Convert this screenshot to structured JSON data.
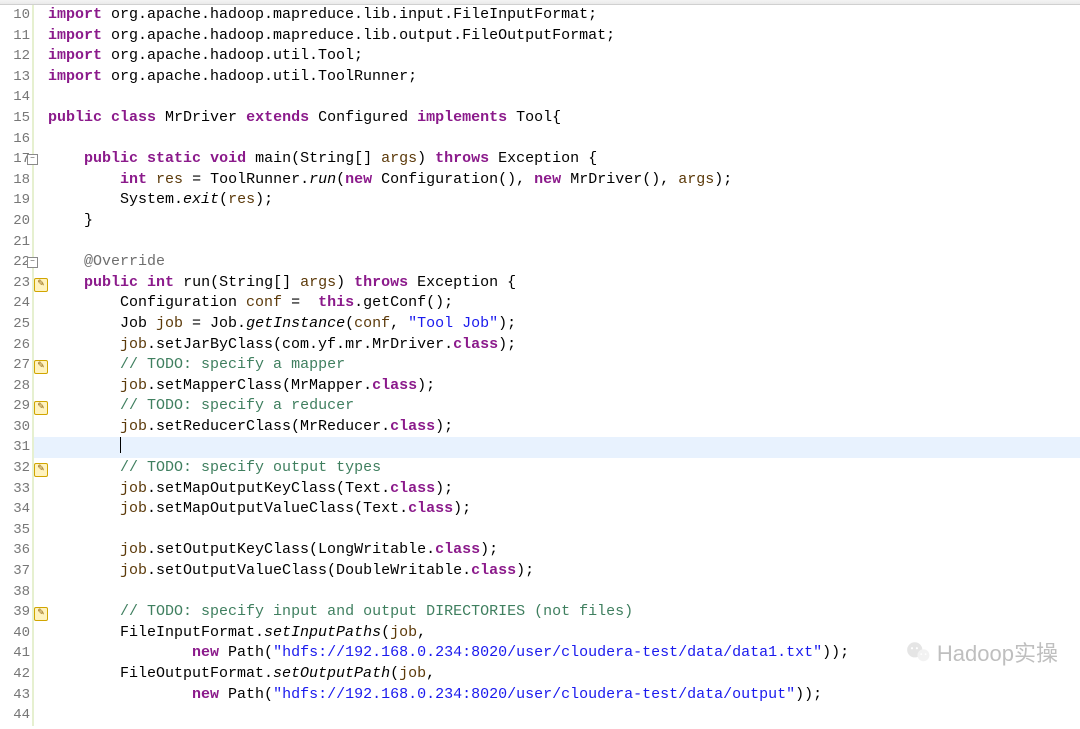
{
  "watermark_text": "Hadoop实操",
  "lines": [
    {
      "num": "10",
      "marker": "",
      "tokens": [
        {
          "c": "kw",
          "t": "import"
        },
        {
          "t": " org.apache.hadoop.mapreduce.lib.input.FileInputFormat;"
        }
      ]
    },
    {
      "num": "11",
      "marker": "",
      "tokens": [
        {
          "c": "kw",
          "t": "import"
        },
        {
          "t": " org.apache.hadoop.mapreduce.lib.output.FileOutputFormat;"
        }
      ]
    },
    {
      "num": "12",
      "marker": "",
      "tokens": [
        {
          "c": "kw",
          "t": "import"
        },
        {
          "t": " org.apache.hadoop.util.Tool;"
        }
      ]
    },
    {
      "num": "13",
      "marker": "",
      "tokens": [
        {
          "c": "kw",
          "t": "import"
        },
        {
          "t": " org.apache.hadoop.util.ToolRunner;"
        }
      ]
    },
    {
      "num": "14",
      "marker": "",
      "tokens": [
        {
          "t": " "
        }
      ]
    },
    {
      "num": "15",
      "marker": "",
      "tokens": [
        {
          "c": "kw",
          "t": "public"
        },
        {
          "t": " "
        },
        {
          "c": "kw",
          "t": "class"
        },
        {
          "t": " MrDriver "
        },
        {
          "c": "kw",
          "t": "extends"
        },
        {
          "t": " Configured "
        },
        {
          "c": "kw",
          "t": "implements"
        },
        {
          "t": " Tool{"
        }
      ]
    },
    {
      "num": "16",
      "marker": "",
      "tokens": [
        {
          "t": " "
        }
      ]
    },
    {
      "num": "17",
      "marker": "minus",
      "tokens": [
        {
          "t": "    "
        },
        {
          "c": "kw",
          "t": "public"
        },
        {
          "t": " "
        },
        {
          "c": "kw",
          "t": "static"
        },
        {
          "t": " "
        },
        {
          "c": "kw",
          "t": "void"
        },
        {
          "t": " main(String[] "
        },
        {
          "c": "param",
          "t": "args"
        },
        {
          "t": ") "
        },
        {
          "c": "kw",
          "t": "throws"
        },
        {
          "t": " Exception {"
        }
      ]
    },
    {
      "num": "18",
      "marker": "",
      "tokens": [
        {
          "t": "        "
        },
        {
          "c": "kw",
          "t": "int"
        },
        {
          "t": " "
        },
        {
          "c": "param",
          "t": "res"
        },
        {
          "t": " = ToolRunner."
        },
        {
          "c": "static-italic",
          "t": "run"
        },
        {
          "t": "("
        },
        {
          "c": "kw",
          "t": "new"
        },
        {
          "t": " Configuration(), "
        },
        {
          "c": "kw",
          "t": "new"
        },
        {
          "t": " MrDriver(), "
        },
        {
          "c": "param",
          "t": "args"
        },
        {
          "t": ");"
        }
      ]
    },
    {
      "num": "19",
      "marker": "",
      "tokens": [
        {
          "t": "        System."
        },
        {
          "c": "static-italic",
          "t": "exit"
        },
        {
          "t": "("
        },
        {
          "c": "param",
          "t": "res"
        },
        {
          "t": ");"
        }
      ]
    },
    {
      "num": "20",
      "marker": "",
      "tokens": [
        {
          "t": "    }"
        }
      ]
    },
    {
      "num": "21",
      "marker": "",
      "tokens": [
        {
          "t": " "
        }
      ]
    },
    {
      "num": "22",
      "marker": "minus",
      "tokens": [
        {
          "t": "    "
        },
        {
          "c": "ann",
          "t": "@Override"
        }
      ]
    },
    {
      "num": "23",
      "marker": "qf",
      "tokens": [
        {
          "t": "    "
        },
        {
          "c": "kw",
          "t": "public"
        },
        {
          "t": " "
        },
        {
          "c": "kw",
          "t": "int"
        },
        {
          "t": " run(String[] "
        },
        {
          "c": "param",
          "t": "args"
        },
        {
          "t": ") "
        },
        {
          "c": "kw",
          "t": "throws"
        },
        {
          "t": " Exception {"
        }
      ]
    },
    {
      "num": "24",
      "marker": "",
      "tokens": [
        {
          "t": "        Configuration "
        },
        {
          "c": "param",
          "t": "conf"
        },
        {
          "t": " =  "
        },
        {
          "c": "kw",
          "t": "this"
        },
        {
          "t": ".getConf();"
        }
      ]
    },
    {
      "num": "25",
      "marker": "",
      "tokens": [
        {
          "t": "        Job "
        },
        {
          "c": "param",
          "t": "job"
        },
        {
          "t": " = Job."
        },
        {
          "c": "static-italic",
          "t": "getInstance"
        },
        {
          "t": "("
        },
        {
          "c": "param",
          "t": "conf"
        },
        {
          "t": ", "
        },
        {
          "c": "str",
          "t": "\"Tool Job\""
        },
        {
          "t": ");"
        }
      ]
    },
    {
      "num": "26",
      "marker": "",
      "tokens": [
        {
          "t": "        "
        },
        {
          "c": "param",
          "t": "job"
        },
        {
          "t": ".setJarByClass(com.yf.mr.MrDriver."
        },
        {
          "c": "kw",
          "t": "class"
        },
        {
          "t": ");"
        }
      ]
    },
    {
      "num": "27",
      "marker": "qf",
      "tokens": [
        {
          "t": "        "
        },
        {
          "c": "comment",
          "t": "// "
        },
        {
          "c": "comment",
          "t": "TODO:"
        },
        {
          "c": "comment",
          "t": " specify a mapper"
        }
      ]
    },
    {
      "num": "28",
      "marker": "",
      "tokens": [
        {
          "t": "        "
        },
        {
          "c": "param",
          "t": "job"
        },
        {
          "t": ".setMapperClass(MrMapper."
        },
        {
          "c": "kw",
          "t": "class"
        },
        {
          "t": ");"
        }
      ]
    },
    {
      "num": "29",
      "marker": "qf",
      "tokens": [
        {
          "t": "        "
        },
        {
          "c": "comment",
          "t": "// "
        },
        {
          "c": "comment",
          "t": "TODO:"
        },
        {
          "c": "comment",
          "t": " specify a reducer"
        }
      ]
    },
    {
      "num": "30",
      "marker": "",
      "tokens": [
        {
          "t": "        "
        },
        {
          "c": "param",
          "t": "job"
        },
        {
          "t": ".setReducerClass(MrReducer."
        },
        {
          "c": "kw",
          "t": "class"
        },
        {
          "t": ");"
        }
      ]
    },
    {
      "num": "31",
      "marker": "",
      "current": true,
      "tokens": [
        {
          "t": "        "
        },
        {
          "cursor": true
        }
      ]
    },
    {
      "num": "32",
      "marker": "qf",
      "tokens": [
        {
          "t": "        "
        },
        {
          "c": "comment",
          "t": "// "
        },
        {
          "c": "comment",
          "t": "TODO:"
        },
        {
          "c": "comment",
          "t": " specify output types"
        }
      ]
    },
    {
      "num": "33",
      "marker": "",
      "tokens": [
        {
          "t": "        "
        },
        {
          "c": "param",
          "t": "job"
        },
        {
          "t": ".setMapOutputKeyClass(Text."
        },
        {
          "c": "kw",
          "t": "class"
        },
        {
          "t": ");"
        }
      ]
    },
    {
      "num": "34",
      "marker": "",
      "tokens": [
        {
          "t": "        "
        },
        {
          "c": "param",
          "t": "job"
        },
        {
          "t": ".setMapOutputValueClass(Text."
        },
        {
          "c": "kw",
          "t": "class"
        },
        {
          "t": ");"
        }
      ]
    },
    {
      "num": "35",
      "marker": "",
      "tokens": [
        {
          "t": " "
        }
      ]
    },
    {
      "num": "36",
      "marker": "",
      "tokens": [
        {
          "t": "        "
        },
        {
          "c": "param",
          "t": "job"
        },
        {
          "t": ".setOutputKeyClass(LongWritable."
        },
        {
          "c": "kw",
          "t": "class"
        },
        {
          "t": ");"
        }
      ]
    },
    {
      "num": "37",
      "marker": "",
      "tokens": [
        {
          "t": "        "
        },
        {
          "c": "param",
          "t": "job"
        },
        {
          "t": ".setOutputValueClass(DoubleWritable."
        },
        {
          "c": "kw",
          "t": "class"
        },
        {
          "t": ");"
        }
      ]
    },
    {
      "num": "38",
      "marker": "",
      "tokens": [
        {
          "t": " "
        }
      ]
    },
    {
      "num": "39",
      "marker": "qf",
      "tokens": [
        {
          "t": "        "
        },
        {
          "c": "comment",
          "t": "// "
        },
        {
          "c": "comment",
          "t": "TODO:"
        },
        {
          "c": "comment",
          "t": " specify input and output DIRECTORIES (not files)"
        }
      ]
    },
    {
      "num": "40",
      "marker": "",
      "tokens": [
        {
          "t": "        FileInputFormat."
        },
        {
          "c": "static-italic",
          "t": "setInputPaths"
        },
        {
          "t": "("
        },
        {
          "c": "param",
          "t": "job"
        },
        {
          "t": ","
        }
      ]
    },
    {
      "num": "41",
      "marker": "",
      "tokens": [
        {
          "t": "                "
        },
        {
          "c": "kw",
          "t": "new"
        },
        {
          "t": " Path("
        },
        {
          "c": "str",
          "t": "\"hdfs://192.168.0.234:8020/user/cloudera-test/data/data1.txt\""
        },
        {
          "t": "));"
        }
      ]
    },
    {
      "num": "42",
      "marker": "",
      "tokens": [
        {
          "t": "        FileOutputFormat."
        },
        {
          "c": "static-italic",
          "t": "setOutputPath"
        },
        {
          "t": "("
        },
        {
          "c": "param",
          "t": "job"
        },
        {
          "t": ","
        }
      ]
    },
    {
      "num": "43",
      "marker": "",
      "tokens": [
        {
          "t": "                "
        },
        {
          "c": "kw",
          "t": "new"
        },
        {
          "t": " Path("
        },
        {
          "c": "str",
          "t": "\"hdfs://192.168.0.234:8020/user/cloudera-test/data/output\""
        },
        {
          "t": "));"
        }
      ]
    },
    {
      "num": "44",
      "marker": "",
      "tokens": [
        {
          "t": " "
        }
      ]
    }
  ]
}
